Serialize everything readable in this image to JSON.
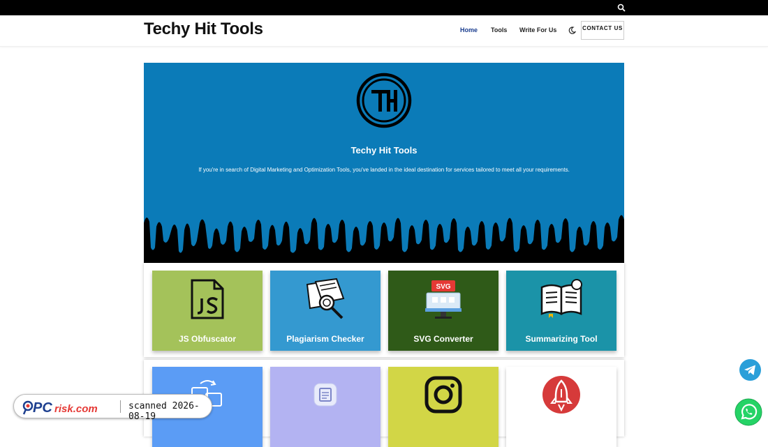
{
  "header": {
    "site_title": "Techy Hit Tools",
    "nav": [
      "Home",
      "Tools",
      "Write For Us"
    ],
    "contact_label": "CONTACT US"
  },
  "hero": {
    "title": "Techy Hit Tools",
    "description": "If you're in search of Digital Marketing and Optimization Tools, you've landed in the ideal destination for services tailored to meet all your requirements.",
    "background_color": "#0b7bb8"
  },
  "tools_row1": [
    {
      "label": "JS Obfuscator",
      "color": "#a4c25a",
      "icon": "js-file-icon"
    },
    {
      "label": "Plagiarism Checker",
      "color": "#3499d0",
      "icon": "plagiarism-search-icon"
    },
    {
      "label": "SVG Converter",
      "color": "#2f5a18",
      "icon": "svg-monitor-icon"
    },
    {
      "label": "Summarizing Tool",
      "color": "#1b93a8",
      "icon": "open-book-icon"
    }
  ],
  "tools_row2": [
    {
      "label": "",
      "color": "#5b9cf5",
      "icon": "image-convert-icon"
    },
    {
      "label": "",
      "color": "#b3b3f2",
      "icon": "document-icon"
    },
    {
      "label": "",
      "color": "#d2d646",
      "icon": "instagram-icon"
    },
    {
      "label": "",
      "color": "#ffffff",
      "icon": "rocket-icon"
    }
  ],
  "overlay": {
    "brand": "PCrisk.com",
    "scan_text": "scanned 2026-08-19"
  }
}
